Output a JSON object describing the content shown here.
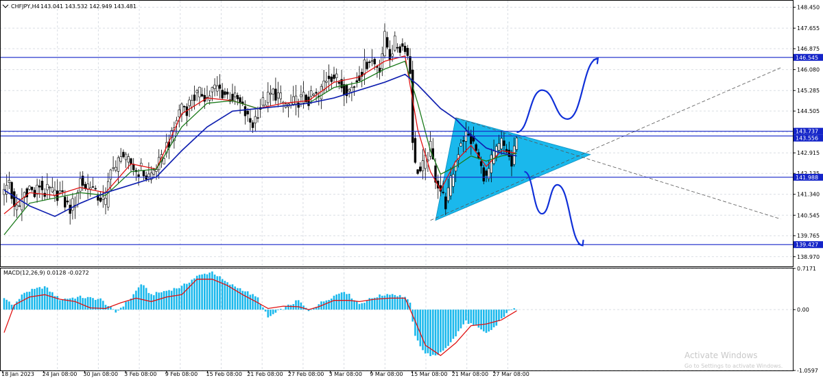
{
  "header": {
    "symbol": "CHFJPY,H4",
    "ohlc": "143.041 143.532 142.949 143.481"
  },
  "chart_data": {
    "type": "candlestick",
    "symbol": "CHFJPY",
    "timeframe": "H4",
    "last_bar": {
      "open": 143.041,
      "high": 143.532,
      "low": 142.949,
      "close": 143.481
    },
    "price_axis": {
      "range": [
        138.6,
        148.7
      ],
      "ticks": [
        "148.450",
        "147.655",
        "146.875",
        "146.080",
        "145.285",
        "144.505",
        "143.710",
        "142.915",
        "142.135",
        "141.340",
        "140.545",
        "139.765",
        "138.970"
      ]
    },
    "time_axis": {
      "labels": [
        "18 Jan 2023",
        "24 Jan 08:00",
        "30 Jan 08:00",
        "3 Feb 08:00",
        "9 Feb 08:00",
        "15 Feb 08:00",
        "21 Feb 08:00",
        "27 Feb 08:00",
        "3 Mar 08:00",
        "9 Mar 08:00",
        "15 Mar 08:00",
        "21 Mar 08:00",
        "27 Mar 08:00"
      ]
    },
    "levels": [
      {
        "value": 146.545,
        "label": "146.545"
      },
      {
        "value": 143.737,
        "label": "143.737"
      },
      {
        "value": 143.556,
        "label": "143.556"
      },
      {
        "value": 141.988,
        "label": "141.988"
      },
      {
        "value": 139.427,
        "label": "139.427"
      }
    ],
    "close_path": [
      [
        0,
        141.4
      ],
      [
        2,
        141.9
      ],
      [
        4,
        140.7
      ],
      [
        6,
        140.9
      ],
      [
        8,
        141.4
      ],
      [
        10,
        141.6
      ],
      [
        12,
        141.3
      ],
      [
        14,
        141.7
      ],
      [
        16,
        141.4
      ],
      [
        18,
        141.5
      ],
      [
        20,
        141.3
      ],
      [
        22,
        141.4
      ],
      [
        24,
        141.0
      ],
      [
        26,
        140.8
      ],
      [
        28,
        141.1
      ],
      [
        30,
        141.9
      ],
      [
        32,
        141.6
      ],
      [
        34,
        141.8
      ],
      [
        36,
        141.3
      ],
      [
        38,
        141.2
      ],
      [
        40,
        141.0
      ],
      [
        42,
        142.5
      ],
      [
        44,
        142.2
      ],
      [
        46,
        143.0
      ],
      [
        48,
        142.6
      ],
      [
        50,
        142.5
      ],
      [
        52,
        142.2
      ],
      [
        54,
        142.3
      ],
      [
        56,
        142.0
      ],
      [
        58,
        142.1
      ],
      [
        60,
        142.4
      ],
      [
        62,
        142.6
      ],
      [
        64,
        143.2
      ],
      [
        66,
        143.5
      ],
      [
        68,
        144.2
      ],
      [
        70,
        144.8
      ],
      [
        72,
        144.6
      ],
      [
        74,
        145.0
      ],
      [
        76,
        145.1
      ],
      [
        78,
        145.2
      ],
      [
        80,
        145.0
      ],
      [
        82,
        145.3
      ],
      [
        84,
        145.4
      ],
      [
        86,
        145.2
      ],
      [
        88,
        145.1
      ],
      [
        90,
        145.0
      ],
      [
        92,
        144.9
      ],
      [
        94,
        144.6
      ],
      [
        96,
        144.2
      ],
      [
        98,
        144.0
      ],
      [
        100,
        144.5
      ],
      [
        102,
        144.8
      ],
      [
        104,
        145.0
      ],
      [
        106,
        145.2
      ],
      [
        108,
        145.1
      ],
      [
        110,
        144.8
      ],
      [
        112,
        144.7
      ],
      [
        114,
        144.8
      ],
      [
        116,
        144.9
      ],
      [
        118,
        145.0
      ],
      [
        120,
        144.9
      ],
      [
        122,
        145.1
      ],
      [
        124,
        145.0
      ],
      [
        126,
        145.6
      ],
      [
        128,
        145.9
      ],
      [
        130,
        145.8
      ],
      [
        132,
        145.6
      ],
      [
        134,
        145.4
      ],
      [
        136,
        145.3
      ],
      [
        138,
        145.5
      ],
      [
        140,
        145.9
      ],
      [
        142,
        146.2
      ],
      [
        144,
        146.5
      ],
      [
        146,
        146.3
      ],
      [
        148,
        146.2
      ],
      [
        150,
        147.3
      ],
      [
        152,
        146.6
      ],
      [
        154,
        147.1
      ],
      [
        156,
        146.9
      ],
      [
        158,
        147.0
      ],
      [
        159,
        146.6
      ],
      [
        160,
        146.0
      ],
      [
        161,
        143.5
      ],
      [
        162,
        142.4
      ],
      [
        164,
        142.2
      ],
      [
        166,
        142.6
      ],
      [
        168,
        143.1
      ],
      [
        170,
        142.0
      ],
      [
        172,
        141.5
      ],
      [
        174,
        141.0
      ],
      [
        176,
        141.8
      ],
      [
        178,
        142.6
      ],
      [
        180,
        143.4
      ],
      [
        182,
        143.6
      ],
      [
        184,
        143.4
      ],
      [
        186,
        143.0
      ],
      [
        188,
        142.3
      ],
      [
        190,
        141.9
      ],
      [
        192,
        142.6
      ],
      [
        194,
        143.0
      ],
      [
        196,
        143.3
      ],
      [
        198,
        143.0
      ],
      [
        200,
        142.4
      ],
      [
        202,
        143.5
      ]
    ],
    "moving_averages": [
      {
        "color": "#e01010",
        "points": [
          [
            0,
            140.6
          ],
          [
            10,
            141.4
          ],
          [
            20,
            141.3
          ],
          [
            30,
            141.6
          ],
          [
            40,
            141.4
          ],
          [
            50,
            142.5
          ],
          [
            60,
            142.3
          ],
          [
            70,
            144.4
          ],
          [
            80,
            145.0
          ],
          [
            90,
            144.9
          ],
          [
            100,
            144.6
          ],
          [
            110,
            144.8
          ],
          [
            120,
            144.9
          ],
          [
            130,
            145.6
          ],
          [
            140,
            145.8
          ],
          [
            150,
            146.4
          ],
          [
            158,
            146.6
          ],
          [
            163,
            143.8
          ],
          [
            168,
            142.2
          ],
          [
            172,
            141.5
          ],
          [
            178,
            142.6
          ],
          [
            184,
            143.2
          ],
          [
            190,
            142.4
          ],
          [
            196,
            143.0
          ],
          [
            202,
            142.9
          ]
        ]
      },
      {
        "color": "#1a7a1a",
        "points": [
          [
            0,
            139.8
          ],
          [
            10,
            141.0
          ],
          [
            20,
            141.2
          ],
          [
            30,
            141.4
          ],
          [
            40,
            141.3
          ],
          [
            50,
            142.2
          ],
          [
            60,
            142.3
          ],
          [
            70,
            143.9
          ],
          [
            80,
            144.8
          ],
          [
            90,
            144.9
          ],
          [
            100,
            144.6
          ],
          [
            110,
            144.7
          ],
          [
            120,
            144.8
          ],
          [
            130,
            145.4
          ],
          [
            140,
            145.6
          ],
          [
            150,
            146.1
          ],
          [
            158,
            146.4
          ],
          [
            163,
            144.8
          ],
          [
            168,
            143.0
          ],
          [
            172,
            142.1
          ],
          [
            178,
            142.4
          ],
          [
            184,
            142.8
          ],
          [
            190,
            142.6
          ],
          [
            196,
            142.8
          ],
          [
            202,
            142.9
          ]
        ]
      },
      {
        "color": "#1020b0",
        "points": [
          [
            0,
            141.5
          ],
          [
            10,
            140.9
          ],
          [
            20,
            140.5
          ],
          [
            30,
            141.0
          ],
          [
            40,
            141.4
          ],
          [
            50,
            141.7
          ],
          [
            60,
            142.0
          ],
          [
            70,
            143.0
          ],
          [
            80,
            143.9
          ],
          [
            90,
            144.5
          ],
          [
            100,
            144.6
          ],
          [
            110,
            144.7
          ],
          [
            120,
            144.8
          ],
          [
            130,
            145.0
          ],
          [
            140,
            145.3
          ],
          [
            150,
            145.6
          ],
          [
            158,
            145.9
          ],
          [
            163,
            145.5
          ],
          [
            168,
            145.0
          ],
          [
            172,
            144.6
          ],
          [
            178,
            144.2
          ],
          [
            184,
            143.6
          ],
          [
            190,
            143.1
          ],
          [
            196,
            142.9
          ],
          [
            202,
            142.8
          ]
        ]
      }
    ],
    "triangle": {
      "color": "#1ab8ec",
      "apex": [
        231,
        142.85
      ],
      "top": [
        178,
        144.25
      ],
      "bottom": [
        170,
        140.35
      ]
    },
    "projections": [
      {
        "color": "#1030d8",
        "direction": "up",
        "points": [
          [
            202,
            143.7
          ],
          [
            212,
            145.3
          ],
          [
            222,
            144.2
          ],
          [
            234,
            146.5
          ]
        ]
      },
      {
        "color": "#1030d8",
        "direction": "down",
        "points": [
          [
            205,
            142.2
          ],
          [
            212,
            140.6
          ],
          [
            218,
            141.7
          ],
          [
            228,
            139.4
          ]
        ]
      }
    ],
    "trendlines": [
      {
        "points": [
          [
            168,
            140.35
          ],
          [
            306,
            146.15
          ]
        ]
      },
      {
        "points": [
          [
            178,
            144.25
          ],
          [
            306,
            140.4
          ]
        ]
      }
    ],
    "macd": {
      "label": "MACD(12,26,9) 0.0128 -0.0272",
      "range": [
        -1.0597,
        0.7171
      ],
      "ticks": [
        "0.7171",
        "0.00",
        "-1.0597"
      ],
      "histogram_color": "#1ab8ec",
      "signal_color": "#e01010",
      "histogram_knots": [
        [
          0,
          0.2
        ],
        [
          4,
          0.08
        ],
        [
          8,
          0.3
        ],
        [
          16,
          0.4
        ],
        [
          22,
          0.18
        ],
        [
          30,
          0.22
        ],
        [
          38,
          0.18
        ],
        [
          44,
          -0.05
        ],
        [
          50,
          0.2
        ],
        [
          54,
          0.45
        ],
        [
          58,
          0.26
        ],
        [
          64,
          0.33
        ],
        [
          70,
          0.4
        ],
        [
          76,
          0.58
        ],
        [
          82,
          0.66
        ],
        [
          88,
          0.46
        ],
        [
          94,
          0.35
        ],
        [
          100,
          0.2
        ],
        [
          104,
          -0.14
        ],
        [
          110,
          0.02
        ],
        [
          116,
          0.16
        ],
        [
          120,
          -0.03
        ],
        [
          124,
          0.1
        ],
        [
          130,
          0.24
        ],
        [
          134,
          0.33
        ],
        [
          140,
          0.1
        ],
        [
          146,
          0.22
        ],
        [
          152,
          0.28
        ],
        [
          158,
          0.22
        ],
        [
          160,
          0.1
        ],
        [
          162,
          -0.48
        ],
        [
          166,
          -0.76
        ],
        [
          170,
          -0.82
        ],
        [
          176,
          -0.58
        ],
        [
          182,
          -0.2
        ],
        [
          186,
          -0.3
        ],
        [
          190,
          -0.42
        ],
        [
          194,
          -0.28
        ],
        [
          198,
          -0.05
        ],
        [
          202,
          0.02
        ]
      ],
      "signal_knots": [
        [
          0,
          -0.4
        ],
        [
          4,
          0.08
        ],
        [
          10,
          0.22
        ],
        [
          16,
          0.26
        ],
        [
          22,
          0.18
        ],
        [
          28,
          0.14
        ],
        [
          34,
          0.03
        ],
        [
          40,
          0.02
        ],
        [
          46,
          0.12
        ],
        [
          52,
          0.2
        ],
        [
          58,
          0.14
        ],
        [
          64,
          0.22
        ],
        [
          70,
          0.26
        ],
        [
          76,
          0.53
        ],
        [
          82,
          0.53
        ],
        [
          88,
          0.42
        ],
        [
          94,
          0.26
        ],
        [
          100,
          0.12
        ],
        [
          104,
          0.02
        ],
        [
          110,
          0.06
        ],
        [
          116,
          0.05
        ],
        [
          120,
          0.0
        ],
        [
          124,
          0.05
        ],
        [
          130,
          0.16
        ],
        [
          136,
          0.16
        ],
        [
          140,
          0.14
        ],
        [
          146,
          0.18
        ],
        [
          152,
          0.2
        ],
        [
          158,
          0.2
        ],
        [
          162,
          -0.2
        ],
        [
          166,
          -0.62
        ],
        [
          172,
          -0.8
        ],
        [
          178,
          -0.58
        ],
        [
          184,
          -0.28
        ],
        [
          190,
          -0.25
        ],
        [
          196,
          -0.18
        ],
        [
          202,
          -0.02
        ]
      ]
    }
  },
  "watermark": {
    "title": "Activate Windows",
    "subtitle": "Go to Settings to activate Windows."
  }
}
